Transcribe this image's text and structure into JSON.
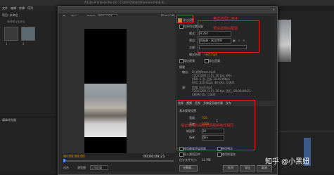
{
  "app": {
    "title": "Adobe Premiere Pro CC - C:\\用户\\Adobe\\Premiere Pro\\8.0\\...",
    "menu": [
      "文件",
      "编辑",
      "剪辑",
      "序列"
    ],
    "project_tab": "项目: 未命名",
    "project_file": "未命名.prproj",
    "media_browser": "媒体浏览器",
    "seq_label": "1",
    "file_label": "4"
  },
  "dialog": {
    "title": "导出设置",
    "source_tab": "源",
    "output_tab": "输出",
    "source_scaling": "源缩放:",
    "source_scaling_value": "缩放以适合",
    "timecode_left": "00;00;00;00",
    "timecode_right": "00;00;09;21",
    "fit_label": "适合",
    "range_label": "源范围",
    "range_value": "工作区域"
  },
  "export": {
    "section_label": "导出设置",
    "match_sequence": "与序列设置匹配",
    "format_label": "格式:",
    "format_value": "H.264",
    "preset_label": "预设:",
    "preset_value": "匹配源 - 高比特率",
    "comments_label": "注释:",
    "output_name_label": "输出名称:",
    "output_name_value": "test.mp4",
    "export_video": "导出视频",
    "export_audio": "导出音频",
    "summary_label": "摘要",
    "output_label": "输出:",
    "output_lines": [
      "D:\\视频\\test.mp4",
      "720x1280 (1.0), 30 fps, 逐行",
      "VBR, 1 次, 目标 10.00 Mbps",
      "AAC, 320 kbps, 48 kHz, 立体声"
    ],
    "source_label": "源:",
    "source_lines": [
      "剪辑, test.mp4",
      "720x1280 (1.0), 30 fps, 逐行, 00;00;09;21",
      "48000 Hz, 立体声"
    ]
  },
  "tabs": [
    "效果",
    "视频",
    "音频",
    "多路复用器",
    "字幕",
    "发布"
  ],
  "bitrate": {
    "section_label": "比特率设置",
    "encode_label": "比特率编码:",
    "encode_value": "VBR, 1 次",
    "target_label": "目标比特率 [Mbps]:",
    "target_value": "10",
    "max_label": "最大比特率 [Mbps]:",
    "max_value": "12"
  },
  "video_basic": {
    "section_label": "基本视频设置",
    "width_label": "宽度:",
    "width_value": "720",
    "height_label": "高度:",
    "height_value": "1280",
    "frame_rate_label": "帧速率:",
    "frame_rate_value": "30",
    "field_order_label": "场序:",
    "field_order_value": "逐行"
  },
  "bottom_options": {
    "max_render": "使用最高渲染质量",
    "use_previews": "使用预览",
    "frame_blending": "使用帧混合",
    "import_into_project": "导入到项目中",
    "file_size_label": "估计文件大小:",
    "file_size_value": "11 MB"
  },
  "buttons": {
    "metadata": "元数据...",
    "queue": "队列",
    "export": "导出",
    "cancel": "取消"
  },
  "annotations": {
    "format": "格式选择H.264",
    "preset": "预设选择匹配源",
    "resolution": "保证输出的视频和源视频格式相同"
  },
  "watermark": "知乎 @小黑妞",
  "colors": {
    "annotation": "#e02020",
    "accent": "#e08a00",
    "timecode": "#e8a000"
  }
}
